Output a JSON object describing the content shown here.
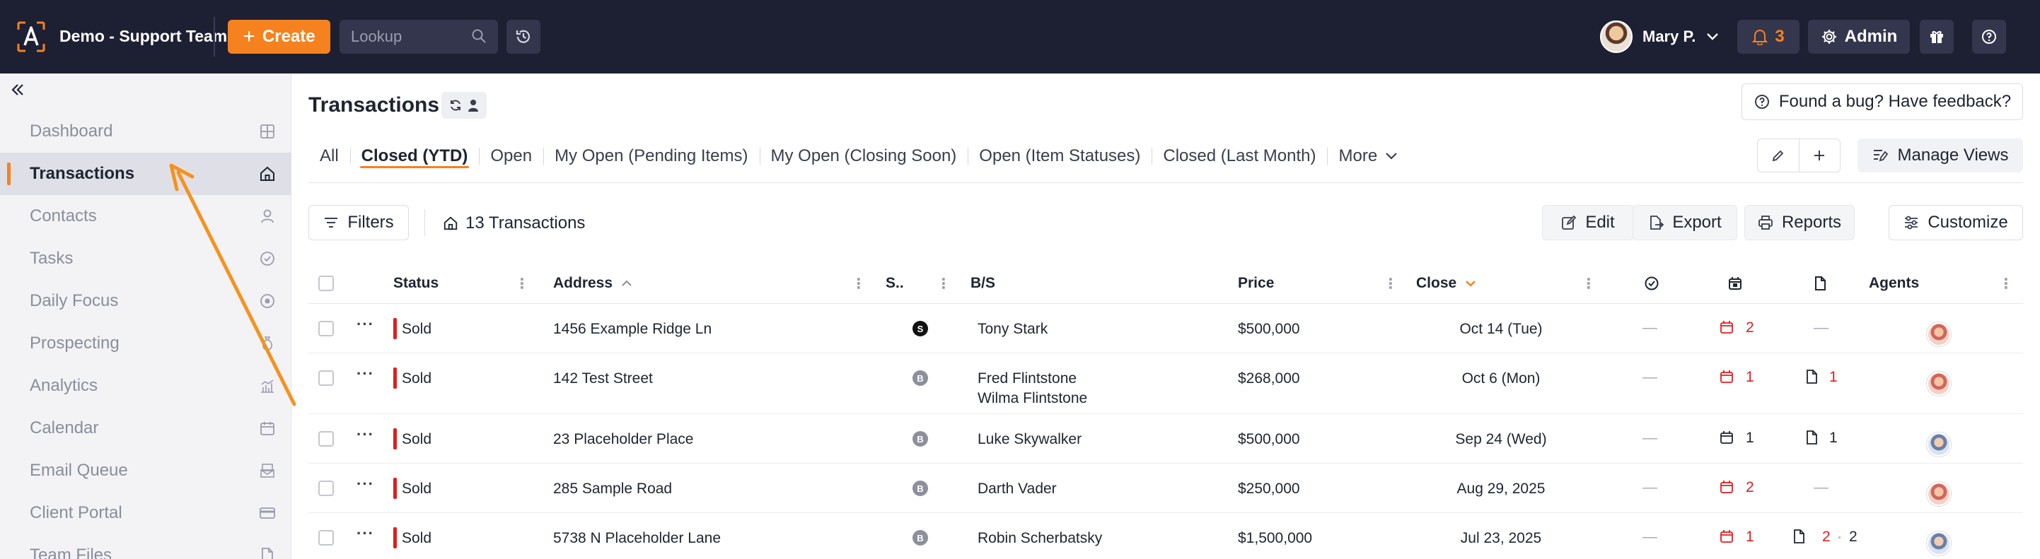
{
  "header": {
    "team_name": "Demo - Support Team",
    "create_label": "Create",
    "lookup_placeholder": "Lookup",
    "user_name": "Mary P.",
    "notification_count": "3",
    "admin_label": "Admin"
  },
  "sidebar": {
    "items": [
      {
        "label": "Dashboard",
        "icon": "grid-icon"
      },
      {
        "label": "Transactions",
        "icon": "home-icon",
        "active": true
      },
      {
        "label": "Contacts",
        "icon": "user-icon"
      },
      {
        "label": "Tasks",
        "icon": "check-circle-icon"
      },
      {
        "label": "Daily Focus",
        "icon": "target-icon"
      },
      {
        "label": "Prospecting",
        "icon": "money-bag-icon"
      },
      {
        "label": "Analytics",
        "icon": "analytics-icon"
      },
      {
        "label": "Calendar",
        "icon": "calendar-icon"
      },
      {
        "label": "Email Queue",
        "icon": "email-queue-icon"
      },
      {
        "label": "Client Portal",
        "icon": "card-icon"
      },
      {
        "label": "Team Files",
        "icon": "file-icon"
      }
    ]
  },
  "main": {
    "title": "Transactions",
    "feedback_label": "Found a bug? Have feedback?",
    "tabs": [
      "All",
      "Closed (YTD)",
      "Open",
      "My Open (Pending Items)",
      "My Open (Closing Soon)",
      "Open (Item Statuses)",
      "Closed (Last Month)",
      "More"
    ],
    "active_tab": "Closed (YTD)",
    "manage_views_label": "Manage Views",
    "filters_label": "Filters",
    "count_label": "13 Transactions",
    "edit_label": "Edit",
    "export_label": "Export",
    "reports_label": "Reports",
    "customize_label": "Customize"
  },
  "table": {
    "columns": {
      "status": "Status",
      "address": "Address",
      "s": "S..",
      "bs": "B/S",
      "price": "Price",
      "close": "Close",
      "agents": "Agents"
    },
    "rows": [
      {
        "status": "Sold",
        "address": "1456 Example Ridge Ln",
        "badge": "S",
        "names": [
          "Tony Stark"
        ],
        "price": "$500,000",
        "close": "Oct 14 (Tue)",
        "cal": "2",
        "cal_red": true,
        "docs": "",
        "docs2": "",
        "agent": "f"
      },
      {
        "status": "Sold",
        "address": "142 Test Street",
        "badge": "B",
        "names": [
          "Fred Flintstone",
          "Wilma Flintstone"
        ],
        "price": "$268,000",
        "close": "Oct 6 (Mon)",
        "cal": "1",
        "cal_red": true,
        "docs": "1",
        "docs_red": true,
        "docs2": "",
        "agent": "f"
      },
      {
        "status": "Sold",
        "address": "23 Placeholder Place",
        "badge": "B",
        "names": [
          "Luke Skywalker"
        ],
        "price": "$500,000",
        "close": "Sep 24 (Wed)",
        "cal": "1",
        "cal_red": false,
        "docs": "1",
        "docs_red": false,
        "docs2": "",
        "agent": "m"
      },
      {
        "status": "Sold",
        "address": "285 Sample Road",
        "badge": "B",
        "names": [
          "Darth Vader"
        ],
        "price": "$250,000",
        "close": "Aug 29, 2025",
        "cal": "2",
        "cal_red": true,
        "docs": "",
        "docs2": "",
        "agent": "f"
      },
      {
        "status": "Sold",
        "address": "5738 N Placeholder Lane",
        "badge": "B",
        "names": [
          "Robin Scherbatsky"
        ],
        "price": "$1,500,000",
        "close": "Jul 23, 2025",
        "cal": "1",
        "cal_red": true,
        "docs": "2",
        "docs_red": true,
        "docs2": "2",
        "agent": "m"
      }
    ]
  },
  "colors": {
    "topbar": "#1d1f32",
    "accent": "#f5821f",
    "status_sold": "#e01e1e"
  }
}
